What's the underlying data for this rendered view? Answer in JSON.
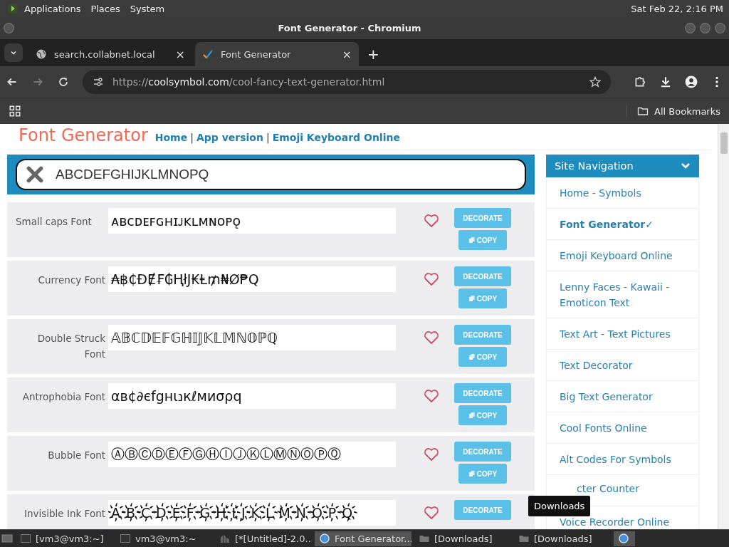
{
  "top_panel": {
    "menus": [
      "Applications",
      "Places",
      "System"
    ],
    "clock": "Sat Feb 22,  2:16 PM"
  },
  "window": {
    "title": "Font Generator - Chromium"
  },
  "tabs": [
    {
      "label": "search.collabnet.local",
      "selected": false,
      "close": "×"
    },
    {
      "label": "Font Generator",
      "selected": true,
      "close": "×"
    }
  ],
  "new_tab": "+",
  "address_bar": {
    "scheme": "https://",
    "host": "coolsymbol.com",
    "path": "/cool-fancy-text-generator.html"
  },
  "bookmarks_bar": {
    "all_bookmarks": "All Bookmarks"
  },
  "page": {
    "site_title": "Font Generator",
    "header_links": [
      {
        "label": "Home"
      },
      {
        "separator": "|",
        "label": "App version"
      },
      {
        "separator": "|",
        "label": "Emoji Keyboard Online"
      }
    ],
    "input": {
      "value": "ABCDEFGHIJKLMNOPQ"
    },
    "rows": [
      {
        "label": "Small caps Font",
        "output": "ᴀʙᴄᴅᴇꜰɢʜɪᴊᴋʟᴍɴᴏᴘǫ",
        "decorate": "DECORATE",
        "copy": "COPY"
      },
      {
        "label": "Currency Font",
        "output": "₳฿₵ĐɆ₣₲ⱧłJ₭Ⱡ₥₦Ø₱Q",
        "decorate": "DECORATE",
        "copy": "COPY"
      },
      {
        "label": "Double Struck Font",
        "output": "𝔸𝔹ℂ𝔻𝔼𝔽𝔾ℍ𝕀𝕁𝕂𝕃𝕄ℕ𝕆ℙℚ",
        "decorate": "DECORATE",
        "copy": "COPY"
      },
      {
        "label": "Antrophobia Font",
        "output": "αв¢∂єfgнιנкℓмиσρq",
        "decorate": "DECORATE",
        "copy": "COPY"
      },
      {
        "label": "Bubble Font",
        "output": "ⒶⒷⒸⒹⒺⒻⒼⒽⒾⒿⓀⓁⓂⓃⓄⓅⓆ",
        "decorate": "DECORATE",
        "copy": "COPY"
      },
      {
        "label": "Invisible Ink Font",
        "output": "A҉B҉C҉D҉E҉F҉G҉H҉I҉J҉K҉L҉M҉N҉O҉P҉Q҉",
        "decorate": "DECORATE"
      }
    ],
    "sidebar": {
      "title": "Site Navigation",
      "items": [
        {
          "label": "Home - Symbols",
          "selected": false
        },
        {
          "label": "Font Generator✓",
          "selected": true
        },
        {
          "label": "Emoji Keyboard Online",
          "selected": false
        },
        {
          "label": "Lenny Faces - Kawaii - Emoticon Text",
          "selected": false
        },
        {
          "label": "Text Art - Text Pictures",
          "selected": false
        },
        {
          "label": "Text Decorator",
          "selected": false
        },
        {
          "label": "Big Text Generator",
          "selected": false
        },
        {
          "label": "Cool Fonts Online",
          "selected": false
        },
        {
          "label": "Alt Codes For Symbols",
          "selected": false
        },
        {
          "label": "cter Counter",
          "selected": false,
          "covered": true
        },
        {
          "label": "Voice Recorder Online",
          "selected": false
        }
      ]
    }
  },
  "tooltip": "Downloads",
  "taskbar": [
    {
      "label": "[vm3@vm3:~]",
      "kind": "terminal",
      "selected": false
    },
    {
      "label": "vm3@vm3:~",
      "kind": "terminal",
      "selected": false
    },
    {
      "label": "[*[Untitled]-2.0...",
      "kind": "editor",
      "selected": false
    },
    {
      "label": "Font Generator...",
      "kind": "browser",
      "selected": true
    },
    {
      "label": "[Downloads]",
      "kind": "folder",
      "selected": false
    },
    {
      "label": "[Downloads]",
      "kind": "folder",
      "selected": false
    }
  ]
}
